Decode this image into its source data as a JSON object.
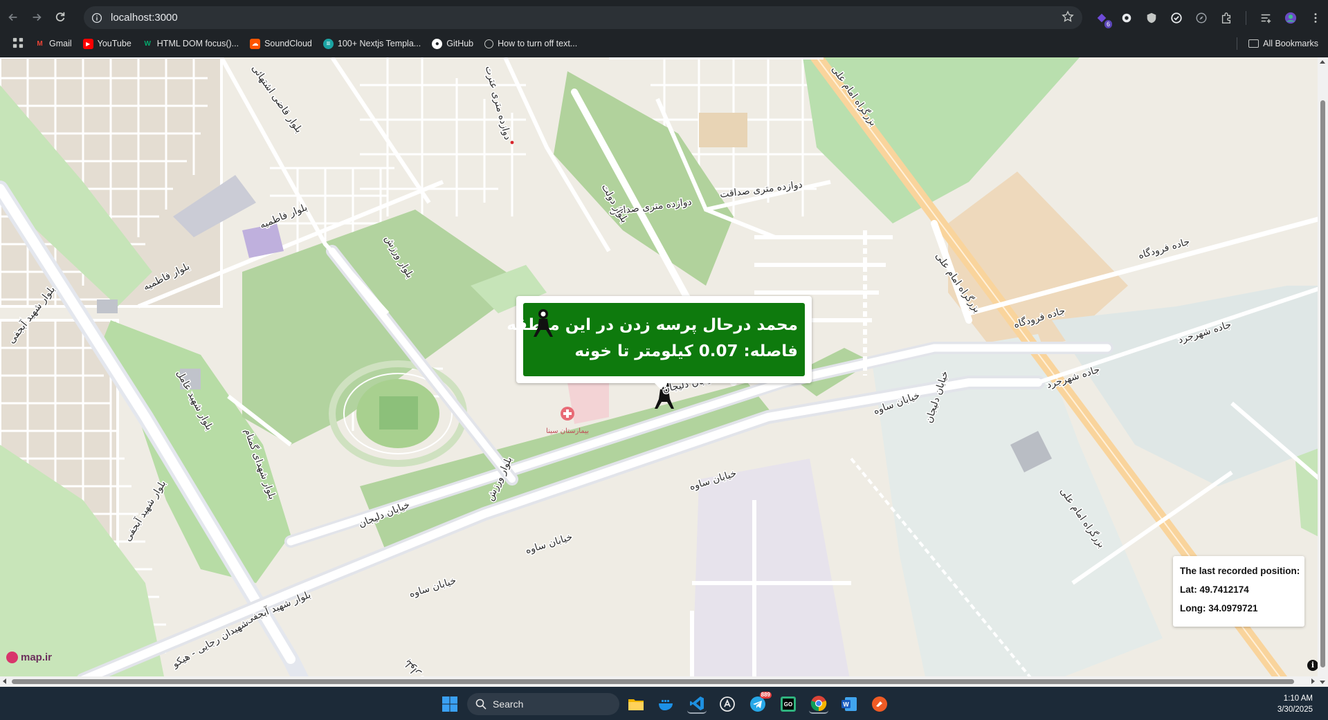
{
  "browser": {
    "url": "localhost:3000",
    "extensions": [
      {
        "name": "purple-ext-icon",
        "badge": "6"
      },
      {
        "name": "circle-ext-icon"
      },
      {
        "name": "shield-ext-icon"
      },
      {
        "name": "check-circle-ext-icon"
      },
      {
        "name": "compass-ext-icon"
      },
      {
        "name": "puzzle-extensions-icon"
      },
      {
        "name": "reading-list-icon"
      },
      {
        "name": "profile-avatar-icon"
      },
      {
        "name": "kebab-menu-icon"
      }
    ]
  },
  "bookmarks": {
    "items": [
      {
        "label": "Gmail",
        "icon": "gmail-icon",
        "color": "#ea4335"
      },
      {
        "label": "YouTube",
        "icon": "youtube-icon",
        "color": "#ff0000"
      },
      {
        "label": "HTML DOM focus()...",
        "icon": "w3schools-icon",
        "color": "#04aa6d"
      },
      {
        "label": "SoundCloud",
        "icon": "soundcloud-icon",
        "color": "#ff5500"
      },
      {
        "label": "100+ Nextjs Templa...",
        "icon": "nextjs-templates-icon",
        "color": "#1aa3a3"
      },
      {
        "label": "GitHub",
        "icon": "github-icon",
        "color": "#ffffff"
      },
      {
        "label": "How to turn off text...",
        "icon": "globe-icon",
        "color": "#c4c7c5"
      }
    ],
    "all_label": "All Bookmarks"
  },
  "map": {
    "popup": {
      "line1": "محمد درحال پرسه زدن در این منطقه",
      "line2": "فاصله: 0.07 کیلومتر تا خونه",
      "background": "#0e7a0d"
    },
    "position_box": {
      "title": "The last recorded position:",
      "lat": "Lat: 49.7412174",
      "long": "Long: 34.0979721"
    },
    "attribution": "map.ir",
    "info_glyph": "i",
    "hospital_label": "بیمارستان سینا",
    "street_labels": {
      "l1": "خیابان دلیجان",
      "l2": "خیابان دلیجان",
      "l3": "خیابان دلیجان",
      "l4": "خیابان ساوه",
      "l5": "خیابان ساوه",
      "l6": "خیابان ساوه",
      "l7": "خیابان ساوه",
      "l8": "بزرگراه امام علی",
      "l9": "بزرگراه امام علی",
      "l10": "بزرگراه امام علی",
      "l11": "بلوار شهید آبجفی",
      "l12": "بلوار شهید آبجفی",
      "l13": "بلوار شهید آبجفی",
      "l14": "بلوار شهید آبجفی",
      "l15": "شهیدان رجایی - هیکو",
      "l16": "بلوار فاطمیه",
      "l17": "بلوار فاطمیه",
      "l18": "بلوار ورزش",
      "l19": "بلوار ورزش",
      "l20": "بلوار قاضی اشتهائی",
      "l21": "دوازده متری صداقت",
      "l22": "دوازده متری صداقت",
      "l23": "دوازده متری عترت",
      "l24": "جاده فرودگاه",
      "l25": "جاده فرودگاه",
      "l26": "جاده شهرجرد",
      "l27": "جاده شهرجرد",
      "l28": "بلوار دولت",
      "l29": "بلوار شهید عامل",
      "l30": "بلوار شهدای گمنام"
    }
  },
  "taskbar": {
    "search_label": "Search",
    "apps": [
      {
        "name": "file-explorer-icon",
        "color": "#f4b400"
      },
      {
        "name": "docker-icon",
        "color": "#1d91e6"
      },
      {
        "name": "vscode-icon",
        "color": "#1e90e0"
      },
      {
        "name": "ai-app-icon",
        "color": "#e8e8e8"
      },
      {
        "name": "telegram-icon",
        "color": "#27a7e7",
        "badge": "889"
      },
      {
        "name": "goland-icon",
        "color": "#2fb37e"
      },
      {
        "name": "chrome-icon",
        "color": "#4285f4"
      },
      {
        "name": "word-icon",
        "color": "#185abd"
      },
      {
        "name": "postman-icon",
        "color": "#ef5b25"
      }
    ],
    "time": "1:10 AM",
    "date": "3/30/2025"
  }
}
